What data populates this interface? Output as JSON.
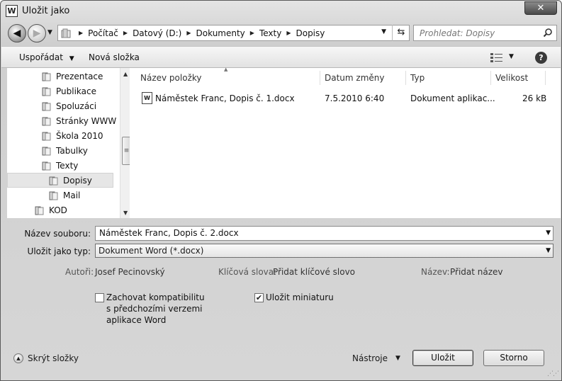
{
  "window": {
    "title": "Uložit jako",
    "app_icon_letter": "W",
    "close_glyph": "✕"
  },
  "nav": {
    "breadcrumbs": [
      "Počítač",
      "Datový (D:)",
      "Dokumenty",
      "Texty",
      "Dopisy"
    ],
    "search_placeholder": "Prohledat: Dopisy"
  },
  "toolbar": {
    "organize_label": "Uspořádat",
    "new_folder_label": "Nová složka",
    "help_label": "?"
  },
  "tree": {
    "items": [
      {
        "label": "Prezentace",
        "selected": false
      },
      {
        "label": "Publikace",
        "selected": false
      },
      {
        "label": "Spoluzáci",
        "selected": false
      },
      {
        "label": "Stránky WWW",
        "selected": false
      },
      {
        "label": "Škola 2010",
        "selected": false
      },
      {
        "label": "Tabulky",
        "selected": false
      },
      {
        "label": "Texty",
        "selected": false
      },
      {
        "label": "Dopisy",
        "selected": true
      },
      {
        "label": "Mail",
        "selected": false
      },
      {
        "label": "KOD",
        "selected": false
      }
    ]
  },
  "filelist": {
    "columns": [
      "Název položky",
      "Datum změny",
      "Typ",
      "Velikost"
    ],
    "rows": [
      {
        "name": "Náměstek Franc, Dopis č. 1.docx",
        "date": "7.5.2010 6:40",
        "type": "Dokument aplikac...",
        "size": "26 kB",
        "icon": "word-doc-icon"
      }
    ]
  },
  "form": {
    "filename_label": "Název souboru:",
    "filename_value": "Náměstek Franc, Dopis č. 2.docx",
    "filetype_label": "Uložit jako typ:",
    "filetype_value": "Dokument Word (*.docx)",
    "authors_label": "Autoři:",
    "authors_value": "Josef Pecinovský",
    "tags_label": "Klíčová slova:",
    "tags_value": "Přidat klíčové slovo",
    "title_label": "Název:",
    "title_value": "Přidat název",
    "compat_label": "Zachovat kompatibilitu s předchozími verzemi aplikace Word",
    "compat_checked": false,
    "thumb_label": "Uložit miniaturu",
    "thumb_checked": true
  },
  "footer": {
    "hide_folders_label": "Skrýt složky",
    "tools_label": "Nástroje",
    "save_label": "Uložit",
    "cancel_label": "Storno"
  }
}
